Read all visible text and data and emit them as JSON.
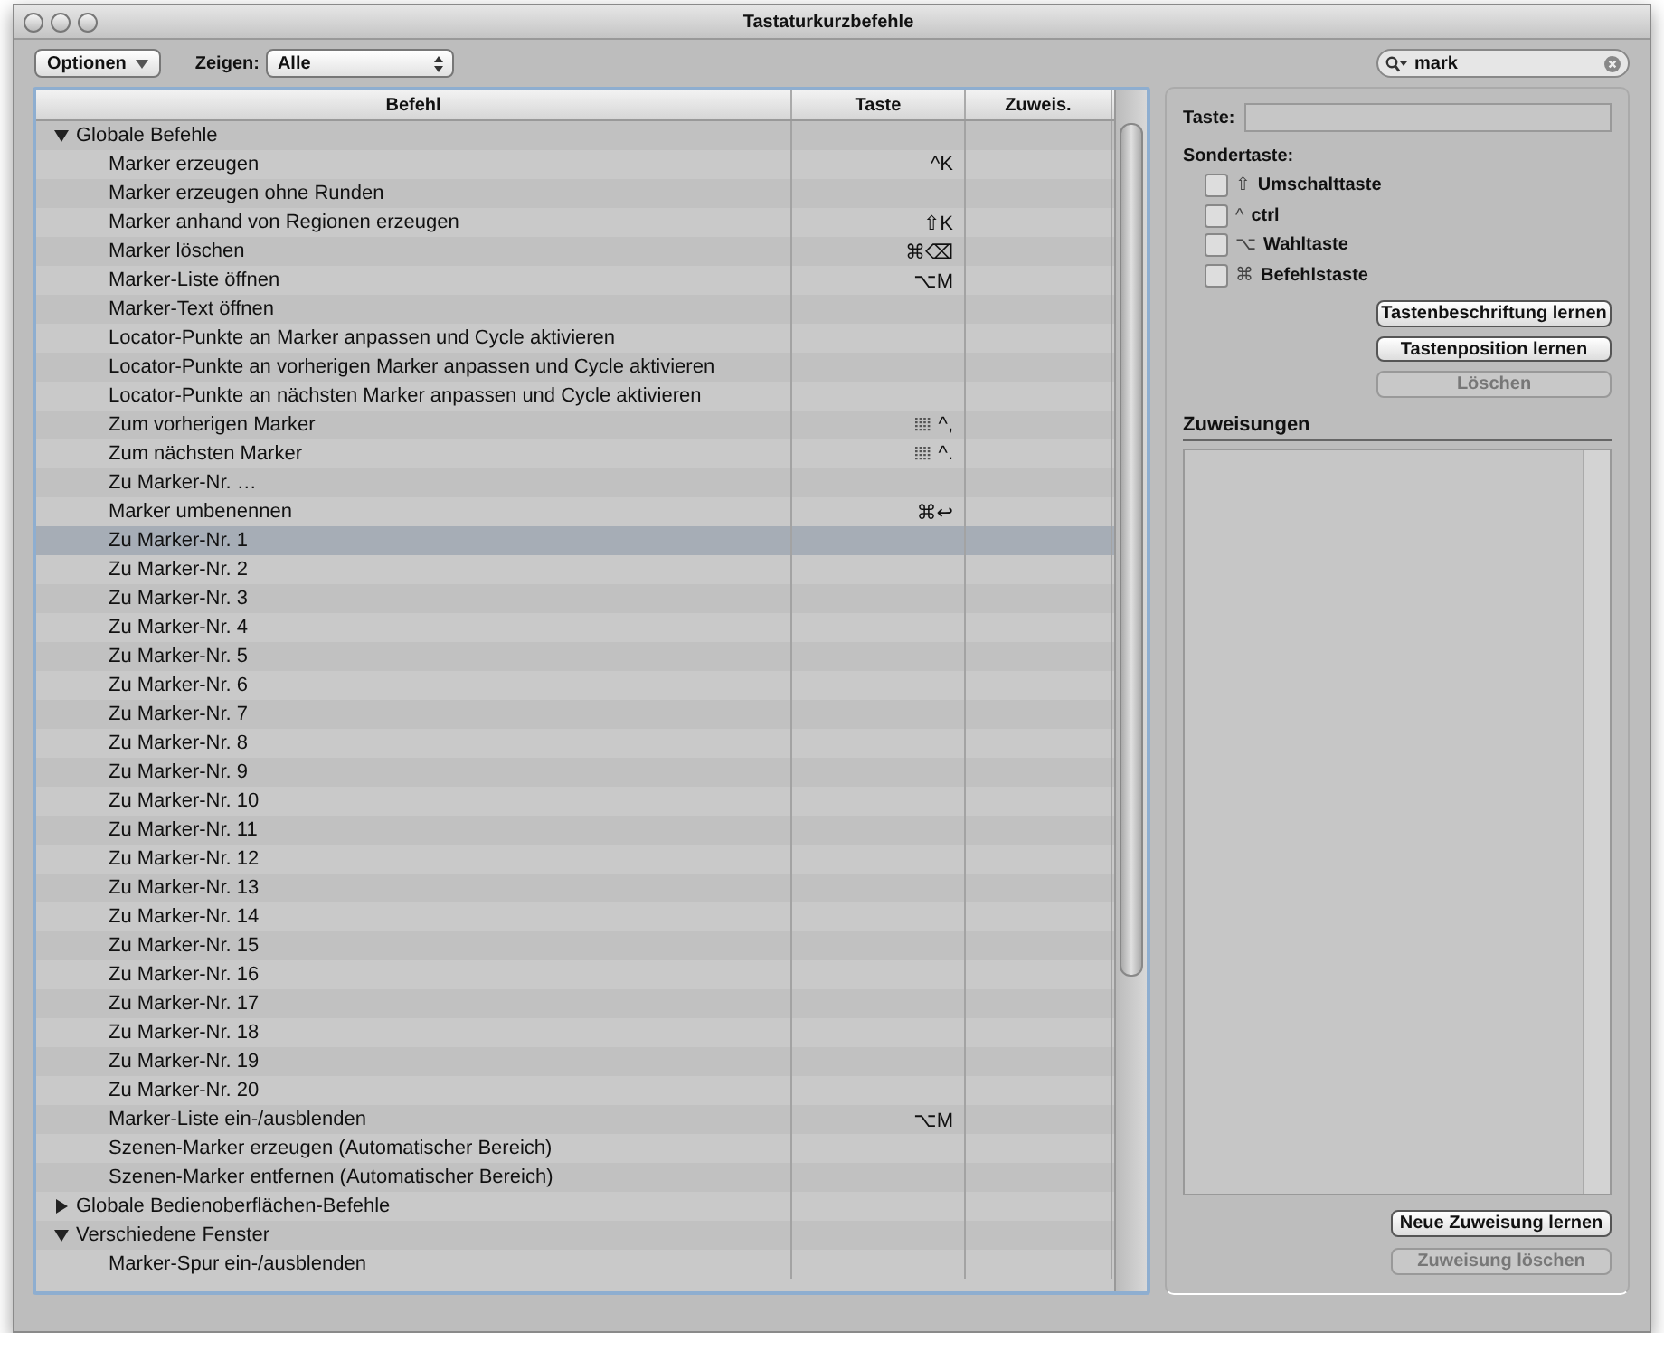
{
  "window": {
    "title": "Tastaturkurzbefehle"
  },
  "toolbar": {
    "options_button": "Optionen",
    "show_label": "Zeigen:",
    "show_value": "Alle",
    "search": {
      "value": "mark"
    }
  },
  "table": {
    "columns": [
      "Befehl",
      "Taste",
      "Zuweis."
    ],
    "groups": [
      {
        "label": "Globale Befehle",
        "expanded": true,
        "selected": false,
        "children": [
          {
            "label": "Marker erzeugen",
            "key": "^K",
            "keypad": false,
            "selected": false
          },
          {
            "label": "Marker erzeugen ohne Runden",
            "keypad": false,
            "selected": false
          },
          {
            "label": "Marker anhand von Regionen erzeugen",
            "key": "⇧K",
            "keypad": false,
            "selected": false
          },
          {
            "label": "Marker löschen",
            "key": "⌘⌫",
            "keypad": false,
            "selected": false
          },
          {
            "label": "Marker-Liste öffnen",
            "key": "⌥M",
            "keypad": false,
            "selected": false
          },
          {
            "label": "Marker-Text öffnen",
            "keypad": false,
            "selected": false
          },
          {
            "label": "Locator-Punkte an Marker anpassen und Cycle aktivieren",
            "keypad": false,
            "selected": false
          },
          {
            "label": "Locator-Punkte an vorherigen Marker anpassen und Cycle aktivieren",
            "keypad": false,
            "selected": false
          },
          {
            "label": "Locator-Punkte an nächsten Marker anpassen und Cycle aktivieren",
            "keypad": false,
            "selected": false
          },
          {
            "label": "Zum vorherigen Marker",
            "key": "^,",
            "keypad": true,
            "selected": false
          },
          {
            "label": "Zum nächsten Marker",
            "key": "^.",
            "keypad": true,
            "selected": false
          },
          {
            "label": "Zu Marker-Nr. …",
            "keypad": false,
            "selected": false
          },
          {
            "label": "Marker umbenennen",
            "key": "⌘↩",
            "keypad": false,
            "selected": false
          },
          {
            "label": "Zu Marker-Nr. 1",
            "keypad": false,
            "selected": true
          },
          {
            "label": "Zu Marker-Nr. 2",
            "keypad": false,
            "selected": false
          },
          {
            "label": "Zu Marker-Nr. 3",
            "keypad": false,
            "selected": false
          },
          {
            "label": "Zu Marker-Nr. 4",
            "keypad": false,
            "selected": false
          },
          {
            "label": "Zu Marker-Nr. 5",
            "keypad": false,
            "selected": false
          },
          {
            "label": "Zu Marker-Nr. 6",
            "keypad": false,
            "selected": false
          },
          {
            "label": "Zu Marker-Nr. 7",
            "keypad": false,
            "selected": false
          },
          {
            "label": "Zu Marker-Nr. 8",
            "keypad": false,
            "selected": false
          },
          {
            "label": "Zu Marker-Nr. 9",
            "keypad": false,
            "selected": false
          },
          {
            "label": "Zu Marker-Nr. 10",
            "keypad": false,
            "selected": false
          },
          {
            "label": "Zu Marker-Nr. 11",
            "keypad": false,
            "selected": false
          },
          {
            "label": "Zu Marker-Nr. 12",
            "keypad": false,
            "selected": false
          },
          {
            "label": "Zu Marker-Nr. 13",
            "keypad": false,
            "selected": false
          },
          {
            "label": "Zu Marker-Nr. 14",
            "keypad": false,
            "selected": false
          },
          {
            "label": "Zu Marker-Nr. 15",
            "keypad": false,
            "selected": false
          },
          {
            "label": "Zu Marker-Nr. 16",
            "keypad": false,
            "selected": false
          },
          {
            "label": "Zu Marker-Nr. 17",
            "keypad": false,
            "selected": false
          },
          {
            "label": "Zu Marker-Nr. 18",
            "keypad": false,
            "selected": false
          },
          {
            "label": "Zu Marker-Nr. 19",
            "keypad": false,
            "selected": false
          },
          {
            "label": "Zu Marker-Nr. 20",
            "keypad": false,
            "selected": false
          },
          {
            "label": "Marker-Liste ein-/ausblenden",
            "key": "⌥M",
            "keypad": false,
            "selected": false
          },
          {
            "label": "Szenen-Marker erzeugen (Automatischer Bereich)",
            "keypad": false,
            "selected": false
          },
          {
            "label": "Szenen-Marker entfernen (Automatischer Bereich)",
            "keypad": false,
            "selected": false
          }
        ]
      },
      {
        "label": "Globale Bedienoberflächen-Befehle",
        "expanded": false,
        "selected": false
      },
      {
        "label": "Verschiedene Fenster",
        "expanded": true,
        "selected": false,
        "children": [
          {
            "label": "Marker-Spur ein-/ausblenden",
            "keypad": false,
            "selected": false
          }
        ]
      }
    ]
  },
  "inspector": {
    "key_label": "Taste:",
    "modifier_label": "Sondertaste:",
    "modifiers": [
      {
        "symbol": "⇧",
        "label": "Umschalttaste",
        "checked": false
      },
      {
        "symbol": "^",
        "label": "ctrl",
        "checked": false
      },
      {
        "symbol": "⌥",
        "label": "Wahltaste",
        "checked": false
      },
      {
        "symbol": "⌘",
        "label": "Befehlstaste",
        "checked": false
      }
    ],
    "learn_buttons": [
      {
        "label": "Tastenbeschriftung lernen",
        "disabled": false
      },
      {
        "label": "Tastenposition lernen",
        "disabled": false
      },
      {
        "label": "Löschen",
        "disabled": true
      }
    ],
    "assignments_title": "Zuweisungen",
    "assignment_buttons": [
      {
        "label": "Neue Zuweisung lernen",
        "disabled": false
      },
      {
        "label": "Zuweisung löschen",
        "disabled": true
      }
    ]
  }
}
